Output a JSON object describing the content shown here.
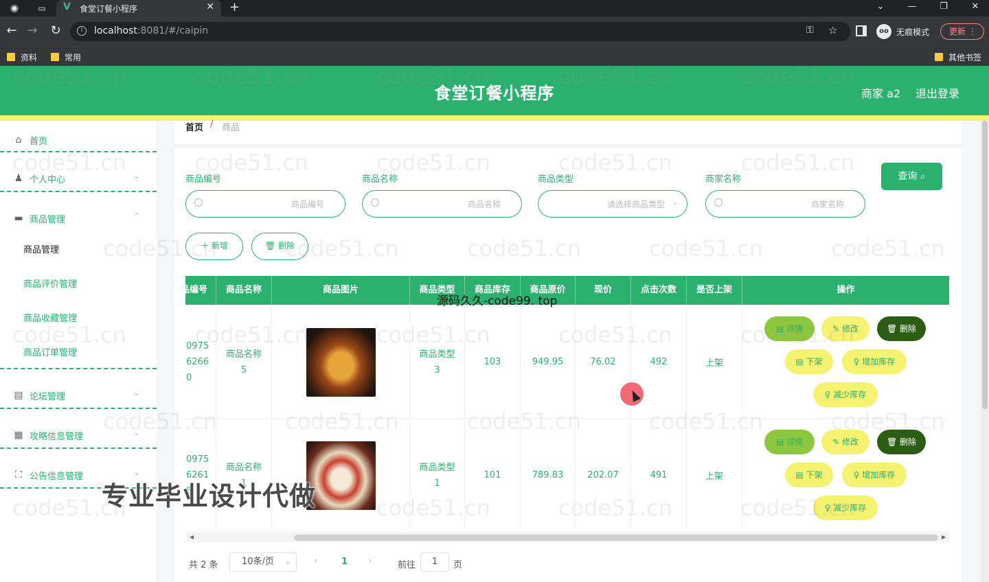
{
  "browser": {
    "tab_title": "食堂订餐小程序",
    "url_host": "localhost",
    "url_rest": ":8081/#/caipin",
    "incognito_label": "无痕模式",
    "update_label": "更新",
    "bookmarks": [
      "资料",
      "常用"
    ],
    "other_bookmarks": "其他书签"
  },
  "header": {
    "title": "食堂订餐小程序",
    "user": "商家 a2",
    "logout": "退出登录"
  },
  "sidebar": {
    "home": "首页",
    "personal": "个人中心",
    "goods_mgmt": "商品管理",
    "sub_items": [
      "商品管理",
      "商品评价管理",
      "商品收藏管理",
      "商品订单管理"
    ],
    "forum": "论坛管理",
    "guide": "攻略信息管理",
    "notice": "公告信息管理"
  },
  "breadcrumb": {
    "home": "首页",
    "sep": "/",
    "current": "商品"
  },
  "filters": {
    "code_label": "商品编号",
    "code_placeholder": "商品编号",
    "name_label": "商品名称",
    "name_placeholder": "商品名称",
    "type_label": "商品类型",
    "type_placeholder": "请选择商品类型",
    "merchant_label": "商家名称",
    "merchant_placeholder": "商家名称",
    "query_label": "查询"
  },
  "actions": {
    "add": "新增",
    "delete": "删除"
  },
  "table": {
    "headers": [
      "商品编号",
      "商品名称",
      "商品图片",
      "商品类型",
      "商品库存",
      "商品原价",
      "现价",
      "点击次数",
      "是否上架",
      "操作"
    ],
    "rows": [
      {
        "code": [
          "0975",
          "6266",
          "0"
        ],
        "name": [
          "商品名称",
          "5"
        ],
        "type": [
          "商品类型",
          "3"
        ],
        "stock": "103",
        "orig_price": "949.95",
        "price": "76.02",
        "clicks": "492",
        "listed": "上架"
      },
      {
        "code": [
          "0975",
          "6261",
          "8"
        ],
        "name": [
          "商品名称",
          "1"
        ],
        "type": [
          "商品类型",
          "1"
        ],
        "stock": "101",
        "orig_price": "789.83",
        "price": "202.07",
        "clicks": "491",
        "listed": "上架"
      }
    ],
    "ops": {
      "detail": "详情",
      "edit": "修改",
      "delete": "删除",
      "unlist": "下架",
      "add_stock": "增加库存",
      "reduce_stock": "减少库存"
    }
  },
  "pagination": {
    "total": "共 2 条",
    "page_size": "10条/页",
    "current": "1",
    "goto": "前往",
    "goto_value": "1",
    "page_unit": "页"
  },
  "overlays": {
    "watermark": "code51.cn",
    "source_text": "源码久久-code99. top",
    "promo": "专业毕业设计代做"
  },
  "colors": {
    "primary": "#2bb06e",
    "accent_yellow": "#f5f171",
    "detail_green": "#8dc63f",
    "danger_dark": "#2b5e14"
  }
}
